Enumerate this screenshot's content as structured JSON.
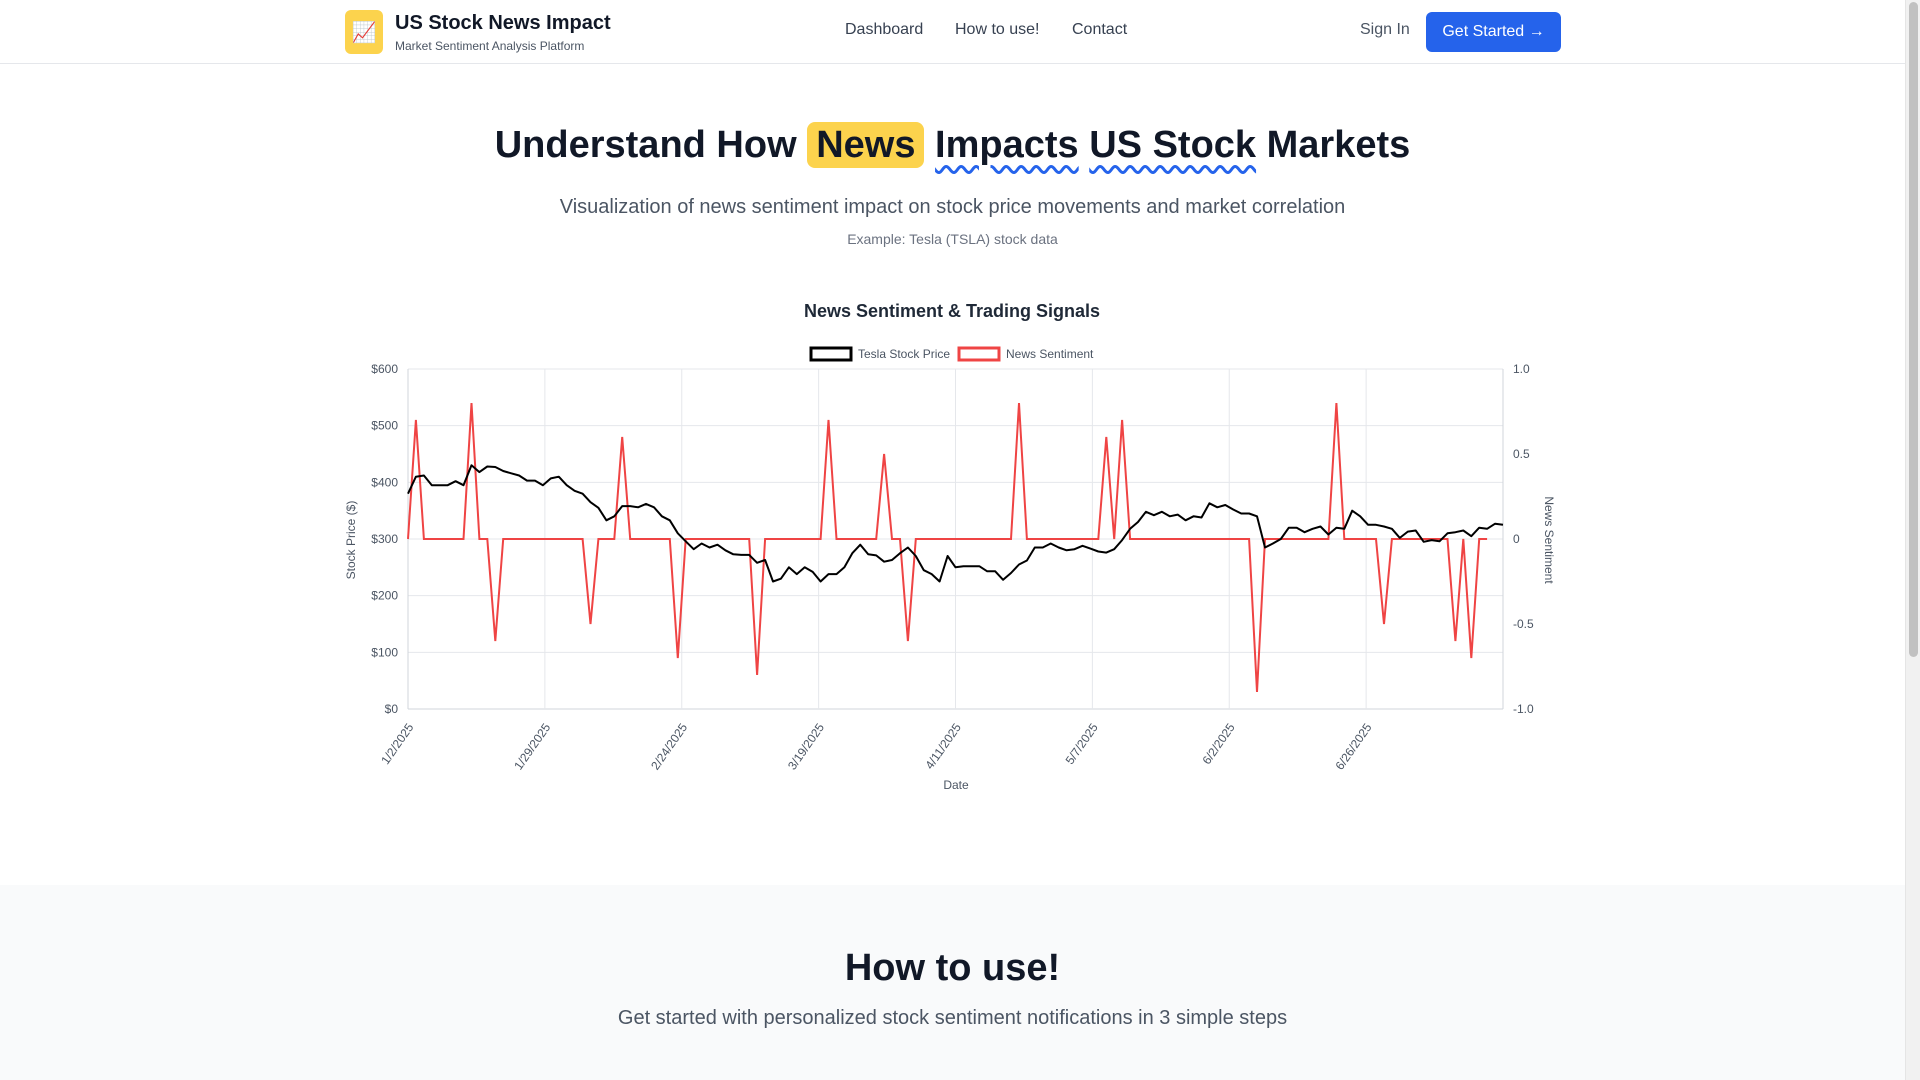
{
  "header": {
    "logo_icon": "📈",
    "brand_title": "US Stock News Impact",
    "brand_subtitle": "Market Sentiment Analysis Platform",
    "nav": [
      "Dashboard",
      "How to use!",
      "Contact"
    ],
    "sign_in": "Sign In",
    "get_started": "Get Started →"
  },
  "hero": {
    "title_pre": "Understand How",
    "title_news": "News",
    "title_impacts": "Impacts",
    "title_us_stock": "US Stock",
    "title_markets": "Markets",
    "subtitle": "Visualization of news sentiment impact on stock price movements and market correlation",
    "example": "Example: Tesla (TSLA) stock data"
  },
  "chart_data": {
    "type": "line",
    "title": "News Sentiment & Trading Signals",
    "xlabel": "Date",
    "ylabel": "Stock Price ($)",
    "y2label": "News Sentiment",
    "ylim": [
      0,
      600
    ],
    "y2lim": [
      -1.0,
      1.0
    ],
    "yticks": [
      "$0",
      "$100",
      "$200",
      "$300",
      "$400",
      "$500",
      "$600"
    ],
    "y2ticks": [
      "-1.0",
      "-0.5",
      "0",
      "0.5",
      "1.0"
    ],
    "xticks": [
      "1/2/2025",
      "1/29/2025",
      "2/24/2025",
      "3/19/2025",
      "4/11/2025",
      "5/7/2025",
      "6/2/2025",
      "6/26/2025"
    ],
    "legend_position": "top",
    "grid": true,
    "colors": {
      "price": "#000000",
      "sentiment": "#ef4444"
    },
    "series": [
      {
        "name": "Tesla Stock Price",
        "axis": "left",
        "values": [
          380,
          410,
          412,
          395,
          395,
          395,
          402,
          395,
          430,
          418,
          428,
          427,
          420,
          416,
          412,
          403,
          403,
          395,
          407,
          410,
          395,
          385,
          380,
          365,
          355,
          333,
          340,
          358,
          358,
          356,
          362,
          356,
          340,
          333,
          310,
          296,
          282,
          292,
          285,
          290,
          280,
          273,
          272,
          272,
          258,
          263,
          225,
          230,
          250,
          238,
          250,
          242,
          225,
          238,
          238,
          250,
          275,
          290,
          273,
          271,
          260,
          263,
          275,
          285,
          270,
          245,
          238,
          225,
          270,
          250,
          252,
          252,
          252,
          243,
          243,
          228,
          240,
          255,
          262,
          285,
          285,
          292,
          285,
          280,
          282,
          288,
          283,
          278,
          276,
          282,
          298,
          318,
          330,
          348,
          342,
          348,
          340,
          343,
          333,
          340,
          338,
          363,
          356,
          360,
          352,
          345,
          345,
          340,
          285,
          292,
          300,
          320,
          320,
          312,
          318,
          322,
          308,
          320,
          318,
          350,
          340,
          325,
          325,
          322,
          318,
          302,
          313,
          315,
          295,
          298,
          296,
          310,
          312,
          315,
          305,
          320,
          318,
          327,
          325
        ]
      },
      {
        "name": "News Sentiment",
        "axis": "right",
        "values": [
          0,
          0.7,
          0,
          0,
          0,
          0,
          0,
          0,
          0.8,
          0,
          0,
          -0.6,
          0,
          0,
          0,
          0,
          0,
          0,
          0,
          0,
          0,
          0,
          0,
          -0.5,
          0,
          0,
          0,
          0.6,
          0,
          0,
          0,
          0,
          0,
          0,
          -0.7,
          0,
          0,
          0,
          0,
          0,
          0,
          0,
          0,
          0,
          -0.8,
          0,
          0,
          0,
          0,
          0,
          0,
          0,
          0,
          0.7,
          0,
          0,
          0,
          0,
          0,
          0,
          0.5,
          0,
          0,
          -0.6,
          0,
          0,
          0,
          0,
          0,
          0,
          0,
          0,
          0,
          0,
          0,
          0,
          0,
          0.8,
          0,
          0,
          0,
          0,
          0,
          0,
          0,
          0,
          0,
          0,
          0.6,
          0,
          0.7,
          0,
          0,
          0,
          0,
          0,
          0,
          0,
          0,
          0,
          0,
          0,
          0,
          0,
          0,
          0,
          0,
          -0.9,
          0,
          0,
          0,
          0,
          0,
          0,
          0,
          0,
          0,
          0.8,
          0,
          0,
          0,
          0,
          0,
          -0.5,
          0,
          0,
          0,
          0,
          0,
          0,
          0,
          0,
          -0.6,
          0,
          -0.7,
          0,
          0
        ]
      }
    ]
  },
  "how": {
    "title": "How to use!",
    "subtitle": "Get started with personalized stock sentiment notifications in 3 simple steps"
  }
}
